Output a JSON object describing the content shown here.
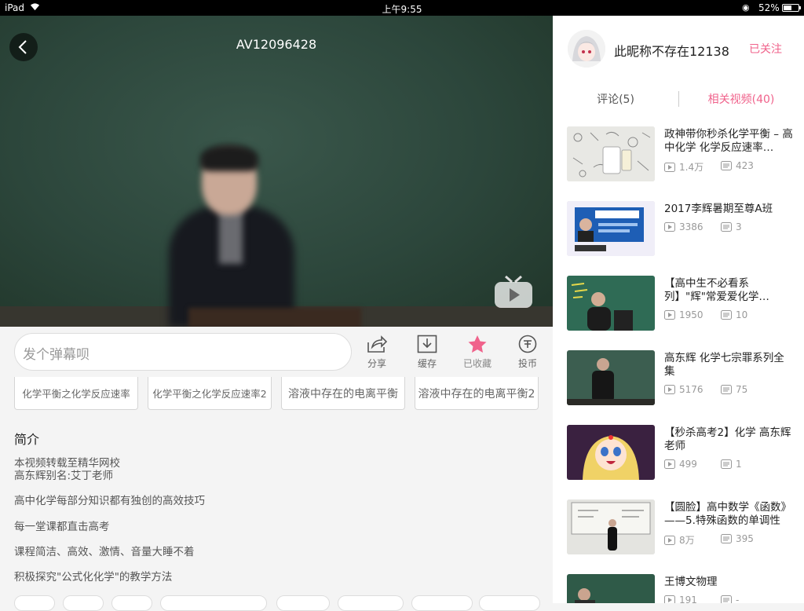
{
  "status_bar": {
    "device": "iPad",
    "time": "上午9:55",
    "battery": "52%"
  },
  "player": {
    "video_id": "AV12096428"
  },
  "actions": {
    "danmu_placeholder": "发个弹幕呗",
    "share": "分享",
    "cache": "缓存",
    "favorited": "已收藏",
    "coin": "投币"
  },
  "tags": [
    "化学平衡之化学反应速率",
    "化学平衡之化学反应速率2",
    "溶液中存在的电离平衡",
    "溶液中存在的电离平衡2"
  ],
  "intro": {
    "heading": "简介",
    "lines": [
      "本视频转载至精华网校",
      "高东辉别名:艾丁老师",
      "高中化学每部分知识都有独创的高效技巧",
      "每一堂课都直击高考",
      "课程简洁、高效、激情、音量大睡不着",
      "积极探究\"公式化化学\"的教学方法"
    ]
  },
  "uploader": {
    "name": "此昵称不存在12138",
    "follow_label": "已关注"
  },
  "tabs": {
    "comments": "评论(5)",
    "related": "相关视频(40)"
  },
  "related": [
    {
      "title": "政神带你秒杀化学平衡 – 高中化学 化学反应速率…",
      "plays": "1.4万",
      "danmaku": "423"
    },
    {
      "title": "2017李辉暑期至尊A班",
      "plays": "3386",
      "danmaku": "3"
    },
    {
      "title": "【高中生不必看系列】\"辉\"常爱爱化学…",
      "plays": "1950",
      "danmaku": "10"
    },
    {
      "title": "高东辉 化学七宗罪系列全集",
      "plays": "5176",
      "danmaku": "75"
    },
    {
      "title": "【秒杀高考2】化学 高东辉老师",
      "plays": "499",
      "danmaku": "1"
    },
    {
      "title": "【圆脸】高中数学《函数》——5.特殊函数的单调性",
      "plays": "8万",
      "danmaku": "395"
    },
    {
      "title": "王博文物理",
      "plays": "191",
      "danmaku": "-"
    }
  ],
  "colors": {
    "accent": "#f0628b",
    "background": "#f4f4f4"
  }
}
